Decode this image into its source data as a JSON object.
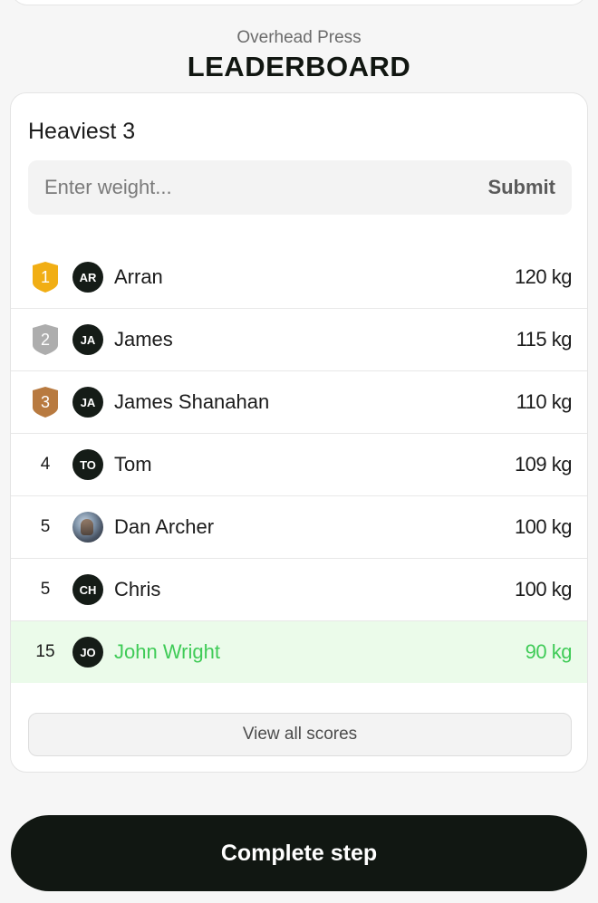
{
  "header": {
    "subtitle": "Overhead Press",
    "title": "LEADERBOARD"
  },
  "card": {
    "heading": "Heaviest 3",
    "input_placeholder": "Enter weight...",
    "submit_label": "Submit",
    "view_all_label": "View all scores"
  },
  "colors": {
    "gold": "#f1ae14",
    "silver": "#adadad",
    "bronze": "#b87a40",
    "highlight_bg": "#ebfbea",
    "highlight_text": "#3fcb57",
    "button_bg": "#111712"
  },
  "leaderboard": [
    {
      "rank": "1",
      "medal": "gold",
      "initials": "AR",
      "name": "Arran",
      "weight": "120 kg"
    },
    {
      "rank": "2",
      "medal": "silver",
      "initials": "JA",
      "name": "James",
      "weight": "115 kg"
    },
    {
      "rank": "3",
      "medal": "bronze",
      "initials": "JA",
      "name": "James Shanahan",
      "weight": "110 kg"
    },
    {
      "rank": "4",
      "medal": "",
      "initials": "TO",
      "name": "Tom",
      "weight": "109 kg"
    },
    {
      "rank": "5",
      "medal": "",
      "initials": "",
      "avatar_icon": "user-photo-icon",
      "name": "Dan Archer",
      "weight": "100 kg"
    },
    {
      "rank": "5",
      "medal": "",
      "initials": "CH",
      "name": "Chris",
      "weight": "100 kg"
    },
    {
      "rank": "15",
      "medal": "",
      "initials": "JO",
      "name": "John Wright",
      "weight": "90 kg",
      "current_user": true
    }
  ],
  "footer": {
    "complete_label": "Complete step"
  }
}
